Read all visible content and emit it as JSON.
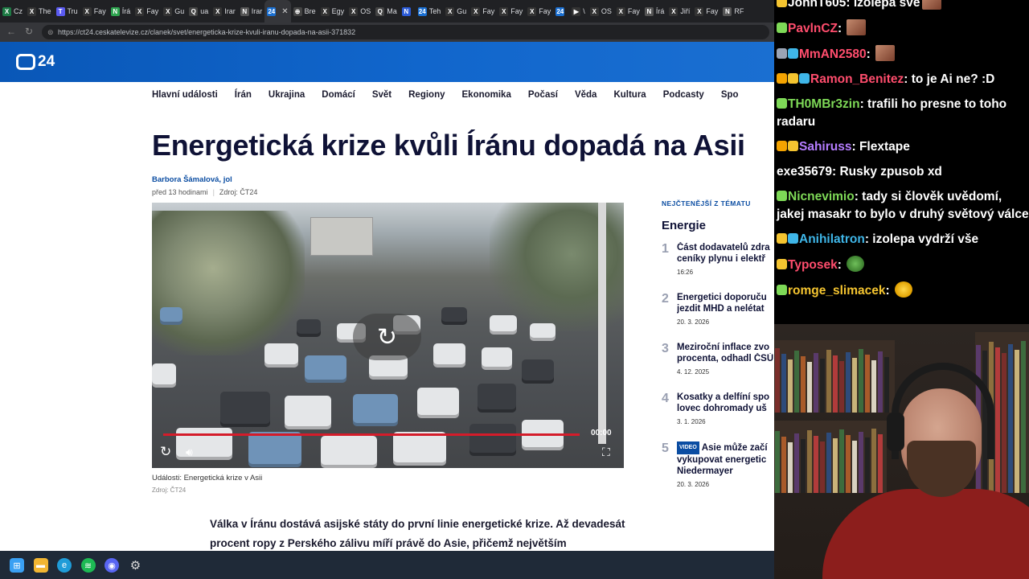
{
  "browser": {
    "tabs": [
      {
        "label": "Cz",
        "icon": "excel-icon",
        "color": "#1d7a44"
      },
      {
        "label": "The",
        "icon": "x-icon",
        "color": "#333333"
      },
      {
        "label": "Tru",
        "icon": "truth-icon",
        "color": "#5a5af0"
      },
      {
        "label": "Fay",
        "icon": "x-icon",
        "color": "#333333"
      },
      {
        "label": "Írá",
        "icon": "news-icon",
        "color": "#2ea44f"
      },
      {
        "label": "Fay",
        "icon": "x-icon",
        "color": "#333333"
      },
      {
        "label": "Gu",
        "icon": "x-icon",
        "color": "#333333"
      },
      {
        "label": "ua",
        "icon": "search-icon",
        "color": "#444444"
      },
      {
        "label": "Irar",
        "icon": "x-icon",
        "color": "#333333"
      },
      {
        "label": "Irar",
        "icon": "news-icon",
        "color": "#555555"
      },
      {
        "label": "",
        "icon": "ct24-icon",
        "color": "#1a6fd1",
        "active": true
      },
      {
        "label": "Bre",
        "icon": "globe-icon",
        "color": "#444444"
      },
      {
        "label": "Egy",
        "icon": "x-icon",
        "color": "#333333"
      },
      {
        "label": "OS",
        "icon": "x-icon",
        "color": "#333333"
      },
      {
        "label": "Ma",
        "icon": "search-icon",
        "color": "#444444"
      },
      {
        "label": "",
        "icon": "news-icon",
        "color": "#2b5bd7"
      },
      {
        "label": "Teh",
        "icon": "ct24-icon",
        "color": "#1a6fd1"
      },
      {
        "label": "Gu",
        "icon": "x-icon",
        "color": "#333333"
      },
      {
        "label": "Fay",
        "icon": "x-icon",
        "color": "#333333"
      },
      {
        "label": "Fay",
        "icon": "x-icon",
        "color": "#333333"
      },
      {
        "label": "Fay",
        "icon": "x-icon",
        "color": "#333333"
      },
      {
        "label": "",
        "icon": "ct24-icon",
        "color": "#1a6fd1"
      },
      {
        "label": "\\",
        "icon": "play-icon",
        "color": "#333333"
      },
      {
        "label": "OS",
        "icon": "x-icon",
        "color": "#333333"
      },
      {
        "label": "Fay",
        "icon": "x-icon",
        "color": "#333333"
      },
      {
        "label": "Írá",
        "icon": "news-icon",
        "color": "#555555"
      },
      {
        "label": "Jiří",
        "icon": "x-icon",
        "color": "#333333"
      },
      {
        "label": "Fay",
        "icon": "x-icon",
        "color": "#333333"
      },
      {
        "label": "RF",
        "icon": "news-icon",
        "color": "#555555"
      }
    ],
    "url": "https://ct24.ceskatelevize.cz/clanek/svet/energeticka-krize-kvuli-iranu-dopada-na-asii-371832"
  },
  "site": {
    "logo_text": "24",
    "brand_color": "#1166cc",
    "menu": [
      "Hlavní události",
      "Írán",
      "Ukrajina",
      "Domácí",
      "Svět",
      "Regiony",
      "Ekonomika",
      "Počasí",
      "Věda",
      "Kultura",
      "Podcasty",
      "Spo"
    ]
  },
  "article": {
    "headline": "Energetická krize kvůli Íránu dopadá na Asii",
    "author": "Barbora Šámalová, jol",
    "time": "před 13 hodinami",
    "source": "Zdroj: ČT24",
    "video": {
      "time": "00:00",
      "progress_fraction": 1.0
    },
    "caption": "Události: Energetická krize v Asii",
    "caption_source": "Zdroj: ČT24",
    "lead": [
      "Válka v Íránu dostává asijské státy do první linie energetické krize. Až devadesát",
      "procent ropy z Perského zálivu míří právě do Asie, přičemž největším"
    ]
  },
  "aside": {
    "kicker": "NEJČTENĚJŠÍ Z TÉMATU",
    "topic": "Energie",
    "items": [
      {
        "num": "1",
        "lines": [
          "Část dodavatelů zdra",
          "ceníky plynu i elektř"
        ],
        "date": "16:26",
        "video": false
      },
      {
        "num": "2",
        "lines": [
          "Energetici doporuču",
          "jezdit MHD a nelétat"
        ],
        "date": "20. 3. 2026",
        "video": false
      },
      {
        "num": "3",
        "lines": [
          "Meziroční inflace zvo",
          "procenta, odhadl ČSÚ"
        ],
        "date": "4. 12. 2025",
        "video": false
      },
      {
        "num": "4",
        "lines": [
          "Kosatky a delfíní spo",
          "lovec dohromady uš"
        ],
        "date": "3. 1. 2026",
        "video": false
      },
      {
        "num": "5",
        "lines": [
          "Asie může začí",
          "vykupovat energetic",
          "Niedermayer"
        ],
        "date": "20. 3. 2026",
        "video": true,
        "video_label": "VIDEO"
      }
    ]
  },
  "chat": [
    {
      "user": "JohnT605",
      "color": "#ffffff",
      "text": "izolepa své",
      "badges": [
        "#f4c430"
      ],
      "emote": true
    },
    {
      "user": "PavlnCZ",
      "color": "#ff4d6d",
      "text": "",
      "badges": [
        "#7ed957"
      ],
      "emote": true
    },
    {
      "user": "MmAN2580",
      "color": "#ff4d6d",
      "text": "",
      "badges": [
        "#9aa4b5",
        "#3fb6e8"
      ],
      "emote": true
    },
    {
      "user": "Ramon_Benitez",
      "color": "#ff4d6d",
      "text": "to je Ai ne? :D",
      "badges": [
        "#f4a300",
        "#f4c430",
        "#3fb6e8"
      ],
      "emote": false
    },
    {
      "user": "TH0MBr3zin",
      "color": "#7ed957",
      "text": "trafili ho presne to toho radaru",
      "badges": [
        "#7ed957"
      ],
      "emote": false
    },
    {
      "user": "Sahiruss",
      "color": "#b57dff",
      "text": "Flextape",
      "badges": [
        "#f4a300",
        "#f4c430"
      ],
      "emote": false
    },
    {
      "user": "exe35679",
      "color": "#ffffff",
      "text": "Rusky zpusob xd",
      "badges": [],
      "emote": false
    },
    {
      "user": "Nicnevimio",
      "color": "#7ed957",
      "text": "tady si člověk uvědomí, jakej masakr to bylo v druhý světový válce",
      "badges": [
        "#7ed957"
      ],
      "emote": false
    },
    {
      "user": "Anihilatron",
      "color": "#3fb6e8",
      "text": "izolepa vydrží vše",
      "badges": [
        "#f4c430",
        "#3fb6e8"
      ],
      "emote": false
    },
    {
      "user": "Typosek",
      "color": "#ff4d6d",
      "text": "",
      "badges": [
        "#f4c430"
      ],
      "emote": true
    },
    {
      "user": "romge_slimacek",
      "color": "#f4c430",
      "text": "",
      "badges": [
        "#7ed957"
      ],
      "emote": true
    }
  ],
  "taskbar": [
    {
      "icon": "windows-icon",
      "color": "#3aa0f3"
    },
    {
      "icon": "folder-icon",
      "color": "#f2b632"
    },
    {
      "icon": "edge-icon",
      "color": "#1f9cd8"
    },
    {
      "icon": "spotify-icon",
      "color": "#1db954"
    },
    {
      "icon": "discord-icon",
      "color": "#5865f2"
    },
    {
      "icon": "settings-icon",
      "color": "#888888"
    }
  ]
}
